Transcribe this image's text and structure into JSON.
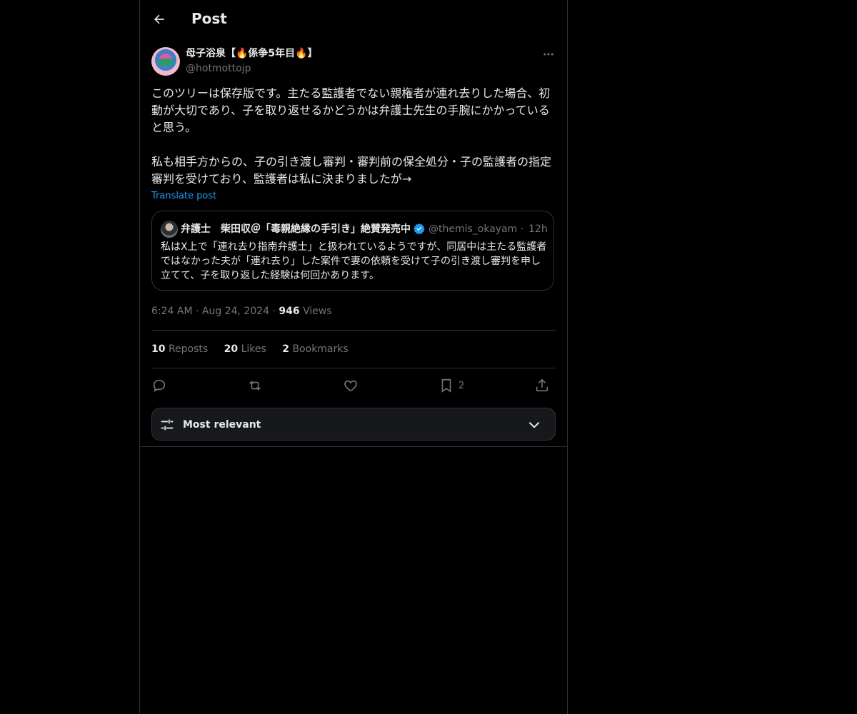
{
  "header": {
    "title": "Post"
  },
  "author": {
    "display_name": "母子浴泉【🔥係争5年目🔥】",
    "handle": "@hotmottojp"
  },
  "post": {
    "text": "このツリーは保存版です。主たる監護者でない親権者が連れ去りした場合、初動が大切であり、子を取り返せるかどうかは弁護士先生の手腕にかかっていると思う。\n\n私も相手方からの、子の引き渡し審判・審判前の保全処分・子の監護者の指定審判を受けており、監護者は私に決まりましたが→",
    "translate_label": "Translate post"
  },
  "quote": {
    "display_name": "弁護士　柴田収＠「毒親絶縁の手引き」絶賛発売中",
    "handle": "@themis_okayama",
    "separator": "·",
    "time": "12h",
    "text": "私はX上で「連れ去り指南弁護士」と扱われているようですが、同居中は主たる監護者ではなかった夫が「連れ去り」した案件で妻の依頼を受けて子の引き渡し審判を申し立てて、子を取り返した経験は何回かあります。"
  },
  "meta": {
    "time": "6:24 AM",
    "date": "Aug 24, 2024",
    "views_count": "946",
    "views_label": "Views",
    "sep": "·"
  },
  "stats": {
    "reposts_count": "10",
    "reposts_label": "Reposts",
    "likes_count": "20",
    "likes_label": "Likes",
    "bookmarks_count": "2",
    "bookmarks_label": "Bookmarks"
  },
  "actions": {
    "bookmark_count": "2"
  },
  "sort": {
    "label": "Most relevant"
  },
  "colors": {
    "background": "#000000",
    "text": "#e7e9ea",
    "secondary": "#71767b",
    "accent": "#1d9bf0",
    "border": "#2f3336"
  },
  "icons": [
    "back-arrow-icon",
    "more-icon",
    "verified-badge-icon",
    "reply-icon",
    "repost-icon",
    "like-icon",
    "bookmark-icon",
    "share-icon",
    "sliders-icon",
    "chevron-down-icon"
  ]
}
